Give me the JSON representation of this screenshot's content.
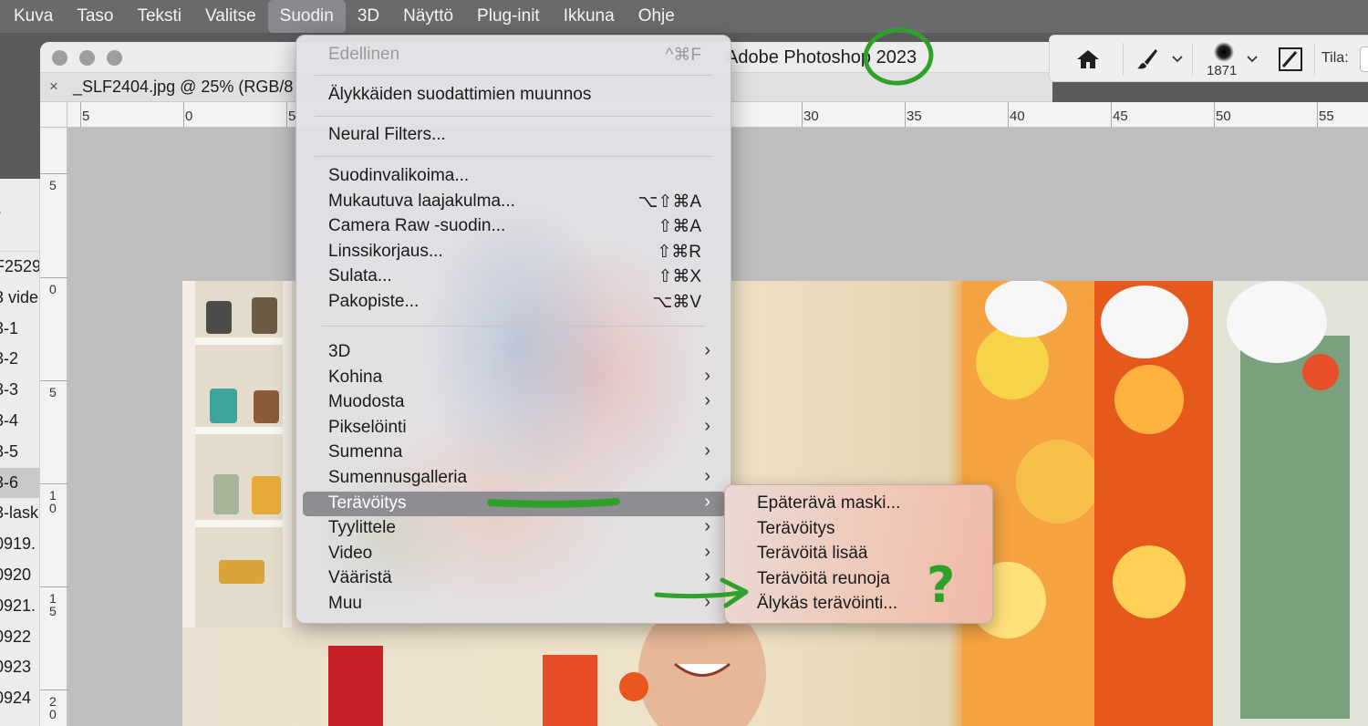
{
  "menubar": {
    "items": [
      "Kuva",
      "Taso",
      "Teksti",
      "Valitse",
      "Suodin",
      "3D",
      "Näyttö",
      "Plug-init",
      "Ikkuna",
      "Ohje"
    ],
    "active_index": 4
  },
  "window": {
    "title": "Adobe Photoshop 2023",
    "tab_close": "×",
    "tab_label": "_SLF2404.jpg @ 25% (RGB/8"
  },
  "ruler_top_labels": [
    "5",
    "0",
    "5",
    "30",
    "35",
    "40",
    "45",
    "50",
    "55"
  ],
  "ruler_left_labels": [
    "5",
    "0",
    "5",
    "1\n0",
    "1\n5",
    "2\n0"
  ],
  "left_panel": {
    "items": [
      "F2529",
      "3 vide",
      "3-1",
      "3-2",
      "3-3",
      "3-4",
      "3-5",
      "3-6",
      "3-lask",
      "0919.",
      "0920",
      "0921.",
      "0922",
      "0923",
      "0924"
    ],
    "selected_index": 7
  },
  "options_bar": {
    "brush_size": "1871",
    "mode_label": "Tila:"
  },
  "filter_menu": {
    "last_filter": {
      "label": "Edellinen",
      "shortcut": "^⌘F"
    },
    "smart_filters": "Älykkäiden suodattimien muunnos",
    "neural": "Neural Filters...",
    "group1": [
      {
        "label": "Suodinvalikoima...",
        "shortcut": ""
      },
      {
        "label": "Mukautuva laajakulma...",
        "shortcut": "⌥⇧⌘A"
      },
      {
        "label": "Camera Raw -suodin...",
        "shortcut": "⇧⌘A"
      },
      {
        "label": "Linssikorjaus...",
        "shortcut": "⇧⌘R"
      },
      {
        "label": "Sulata...",
        "shortcut": "⇧⌘X"
      },
      {
        "label": "Pakopiste...",
        "shortcut": "⌥⌘V"
      }
    ],
    "submenus": [
      "3D",
      "Kohina",
      "Muodosta",
      "Pikselöinti",
      "Sumenna",
      "Sumennusgalleria",
      "Terävöitys",
      "Tyylittele",
      "Video",
      "Vääristä",
      "Muu"
    ],
    "highlighted_submenu": "Terävöitys",
    "arrow": "›"
  },
  "sharpen_submenu": {
    "items": [
      "Epäterävä maski...",
      "Terävöitys",
      "Terävöitä lisää",
      "Terävöitä reunoja",
      "Älykäs terävöinti..."
    ]
  },
  "annotation": {
    "color": "#2fa02a",
    "question_mark": "?"
  },
  "colors": {
    "menubar_bg": "#6a6a6d",
    "menu_highlight": "#8e8e92",
    "submenu_bg": "#efc9b9"
  }
}
